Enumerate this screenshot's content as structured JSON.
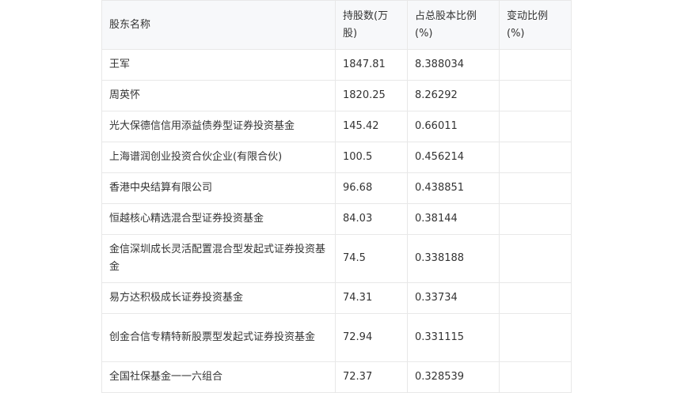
{
  "table": {
    "headers": {
      "name": "股东名称",
      "shares": "持股数(万股)",
      "ratio": "占总股本比例(%)",
      "change": "变动比例(%)"
    },
    "rows": [
      {
        "name": "王军",
        "shares": "1847.81",
        "ratio": "8.388034",
        "change": ""
      },
      {
        "name": "周英怀",
        "shares": "1820.25",
        "ratio": "8.26292",
        "change": ""
      },
      {
        "name": "光大保德信信用添益债券型证券投资基金",
        "shares": "145.42",
        "ratio": "0.66011",
        "change": ""
      },
      {
        "name": "上海谱润创业投资合伙企业(有限合伙)",
        "shares": "100.5",
        "ratio": "0.456214",
        "change": ""
      },
      {
        "name": "香港中央结算有限公司",
        "shares": "96.68",
        "ratio": "0.438851",
        "change": ""
      },
      {
        "name": "恒越核心精选混合型证券投资基金",
        "shares": "84.03",
        "ratio": "0.38144",
        "change": ""
      },
      {
        "name": "金信深圳成长灵活配置混合型发起式证券投资基金",
        "shares": "74.5",
        "ratio": "0.338188",
        "change": ""
      },
      {
        "name": "易方达积极成长证券投资基金",
        "shares": "74.31",
        "ratio": "0.33734",
        "change": ""
      },
      {
        "name": "创金合信专精特新股票型发起式证券投资基金",
        "shares": "72.94",
        "ratio": "0.331115",
        "change": ""
      },
      {
        "name": "全国社保基金一一六组合",
        "shares": "72.37",
        "ratio": "0.328539",
        "change": ""
      }
    ]
  }
}
